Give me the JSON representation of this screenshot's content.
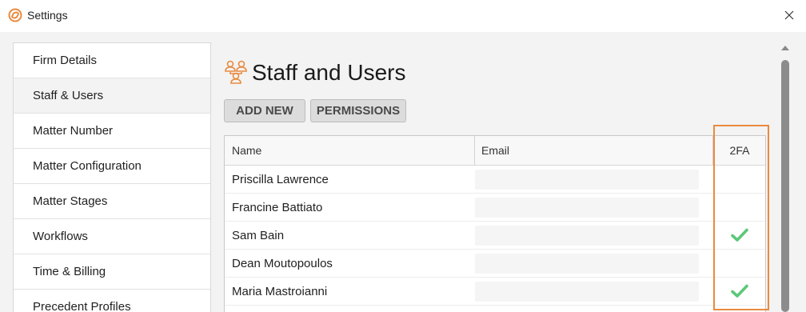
{
  "window": {
    "title": "Settings"
  },
  "sidebar": {
    "items": [
      {
        "label": "Firm Details",
        "active": false
      },
      {
        "label": "Staff & Users",
        "active": true
      },
      {
        "label": "Matter Number",
        "active": false
      },
      {
        "label": "Matter Configuration",
        "active": false
      },
      {
        "label": "Matter Stages",
        "active": false
      },
      {
        "label": "Workflows",
        "active": false
      },
      {
        "label": "Time & Billing",
        "active": false
      },
      {
        "label": "Precedent Profiles",
        "active": false
      }
    ]
  },
  "page": {
    "title": "Staff and Users",
    "icon": "staff-users-icon"
  },
  "toolbar": {
    "add_new_label": "ADD NEW",
    "permissions_label": "PERMISSIONS"
  },
  "table": {
    "columns": {
      "name": "Name",
      "email": "Email",
      "twofa": "2FA"
    },
    "rows": [
      {
        "name": "Priscilla Lawrence",
        "twofa": false
      },
      {
        "name": "Francine Battiato",
        "twofa": false
      },
      {
        "name": "Sam Bain",
        "twofa": true
      },
      {
        "name": "Dean Moutopoulos",
        "twofa": false
      },
      {
        "name": "Maria Mastroianni",
        "twofa": true
      }
    ]
  },
  "colors": {
    "accent": "#e98a3f",
    "check": "#5cc878"
  }
}
